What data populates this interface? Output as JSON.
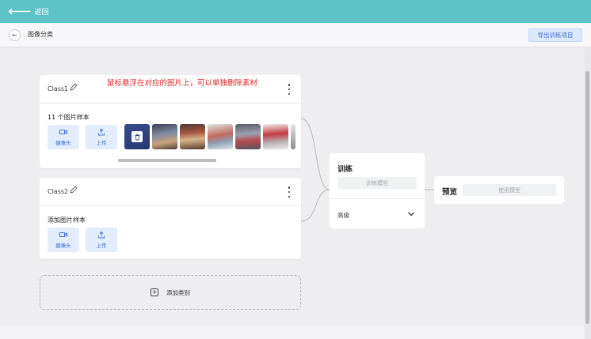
{
  "topbar": {
    "back_label": "返回"
  },
  "header": {
    "title": "图像分类",
    "export_label": "导出训练项目"
  },
  "annotation": {
    "text": "鼠标悬浮在对应的图片上，可以单独删除素材"
  },
  "classes": [
    {
      "name": "Class1",
      "sample_title": "11 个图片样本",
      "webcam_label": "摄像头",
      "upload_label": "上传"
    },
    {
      "name": "Class2",
      "sample_title": "添加图片样本",
      "webcam_label": "摄像头",
      "upload_label": "上传"
    }
  ],
  "add_class_label": "添加类别",
  "training": {
    "title": "训练",
    "train_button": "训练模型",
    "advanced_label": "高级"
  },
  "preview": {
    "title": "预览",
    "use_model_button": "使用模型"
  },
  "colors": {
    "topbar": "#5cc2c5",
    "accent": "#3c6fd8",
    "annotation": "#e02424"
  }
}
